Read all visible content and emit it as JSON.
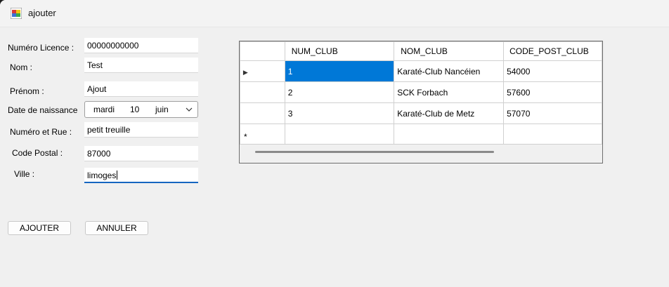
{
  "window": {
    "title": "ajouter"
  },
  "form": {
    "licence": {
      "label": "Numéro Licence :",
      "value": "00000000000"
    },
    "nom": {
      "label": "Nom :",
      "value": "Test"
    },
    "prenom": {
      "label": "Prénom :",
      "value": "Ajout"
    },
    "date": {
      "label": "Date de naissance",
      "day_name": "mardi",
      "day": "10",
      "month": "juin"
    },
    "rue": {
      "label": "Numéro et Rue :",
      "value": "petit treuille"
    },
    "cp": {
      "label": "Code Postal :",
      "value": "87000"
    },
    "ville": {
      "label": "Ville :",
      "value": "limoges"
    }
  },
  "buttons": {
    "ajouter": "AJOUTER",
    "annuler": "ANNULER"
  },
  "grid": {
    "columns": [
      "NUM_CLUB",
      "NOM_CLUB",
      "CODE_POST_CLUB"
    ],
    "rows": [
      [
        "1",
        "Karaté-Club Nancéien",
        "54000"
      ],
      [
        "2",
        "SCK Forbach",
        "57600"
      ],
      [
        "3",
        "Karaté-Club de Metz",
        "57070"
      ]
    ],
    "current_row_marker": "▶",
    "new_row_marker": "*"
  },
  "colors": {
    "selection": "#0078d7",
    "focus_underline": "#1565c0"
  }
}
